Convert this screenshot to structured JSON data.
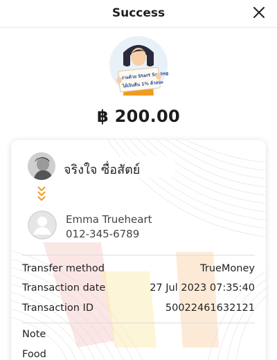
{
  "header": {
    "title": "Success"
  },
  "hero": {
    "banner_line1": "ง่ายด้วย Start Saving",
    "banner_line2": "ได้เงินคืน 1% ด้วยนะ"
  },
  "amount": "฿ 200.00",
  "sender": {
    "name": "จริงใจ ซื่อสัตย์"
  },
  "recipient": {
    "name": "Emma Trueheart",
    "phone": "012-345-6789"
  },
  "details": [
    {
      "label": "Transfer method",
      "value": "TrueMoney"
    },
    {
      "label": "Transaction date",
      "value": "27 Jul 2023 07:35:40"
    },
    {
      "label": "Transaction ID",
      "value": "50022461632121"
    }
  ],
  "note": {
    "label": "Note",
    "value": "Food"
  },
  "colors": {
    "accent_orange": "#f29a1f",
    "text_dark": "#1f1f1f",
    "hero_bg": "#e9f1f8"
  },
  "icons": {
    "close": "close-icon",
    "transfer_direction": "chevron-down-icon",
    "recipient_avatar": "user-avatar-icon"
  }
}
